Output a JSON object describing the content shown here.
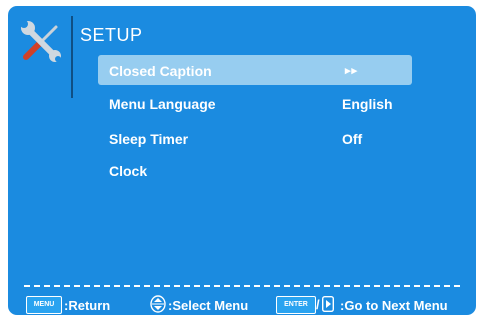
{
  "menu": {
    "title": "SETUP",
    "items": [
      {
        "label": "Closed Caption",
        "value": "▸▸",
        "selected": true
      },
      {
        "label": "Menu Language",
        "value": "English",
        "selected": false
      },
      {
        "label": "Sleep Timer",
        "value": "Off",
        "selected": false
      },
      {
        "label": "Clock",
        "value": "",
        "selected": false
      }
    ]
  },
  "icons": {
    "title_icon": "tools-icon",
    "updown": "up-down-arrow-icon",
    "right": "right-arrow-icon"
  },
  "footer": {
    "menu_badge": "MENU",
    "return_label": ":Return",
    "select_label": ":Select Menu",
    "enter_badge": "ENTER",
    "slash": "/",
    "next_label": ":Go to Next Menu"
  },
  "colors": {
    "background": "#1b8be0",
    "highlight": "#97cdf0",
    "text": "#ffffff"
  }
}
